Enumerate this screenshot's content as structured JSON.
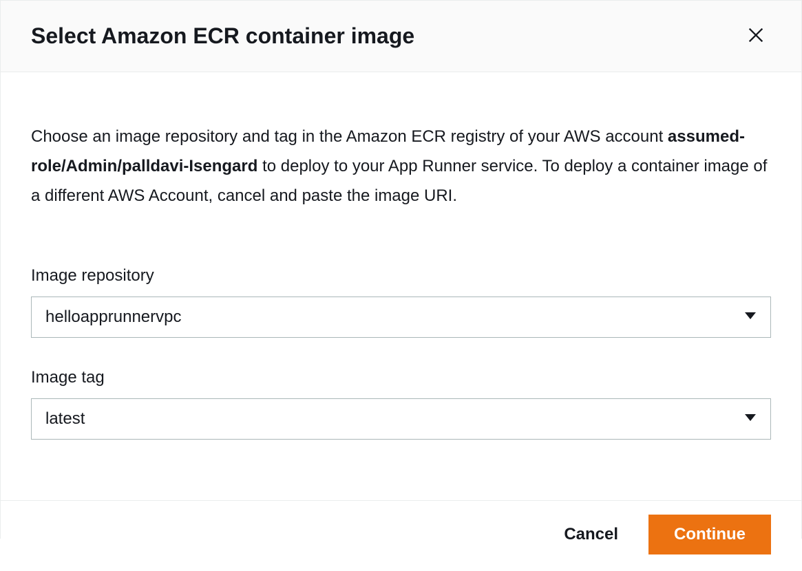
{
  "modal": {
    "title": "Select Amazon ECR container image",
    "description": {
      "prefix": "Choose an image repository and tag in the Amazon ECR registry of your AWS account ",
      "bold": "assumed-role/Admin/palldavi-Isengard",
      "suffix": " to deploy to your App Runner service. To deploy a container image of a different AWS Account, cancel and paste the image URI."
    },
    "fields": {
      "repository": {
        "label": "Image repository",
        "value": "helloapprunnervpc"
      },
      "tag": {
        "label": "Image tag",
        "value": "latest"
      }
    },
    "footer": {
      "cancel": "Cancel",
      "continue": "Continue"
    }
  }
}
